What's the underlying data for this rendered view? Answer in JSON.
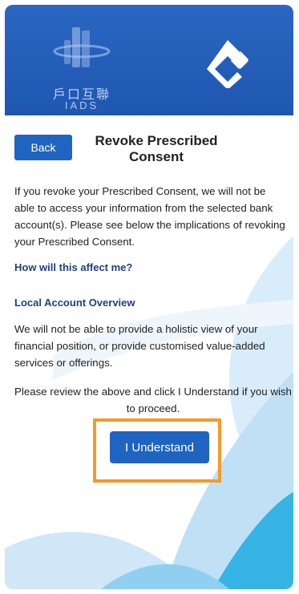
{
  "header": {
    "logo_text": "戶口互聯",
    "logo_sub": "IADS",
    "bank_icon": "bank-logo-icon"
  },
  "page": {
    "back_label": "Back",
    "title": "Revoke Prescribed Consent",
    "intro": "If you revoke your Prescribed Consent, we will not be able to access your information from the selected bank account(s). Please see below the implications of revoking your Prescribed Consent.",
    "affect_heading": "How will this affect me?",
    "local_heading": "Local Account Overview",
    "local_body": "We will not be able to provide a holistic view of your financial position, or provide customised value-added services or offerings.",
    "review_text": "Please review the above and click I Understand if you wish to proceed.",
    "understand_label": "I Understand"
  },
  "colors": {
    "header_blue": "#2a66c2",
    "button_blue": "#1f64c0",
    "highlight_orange": "#f39a2a"
  }
}
